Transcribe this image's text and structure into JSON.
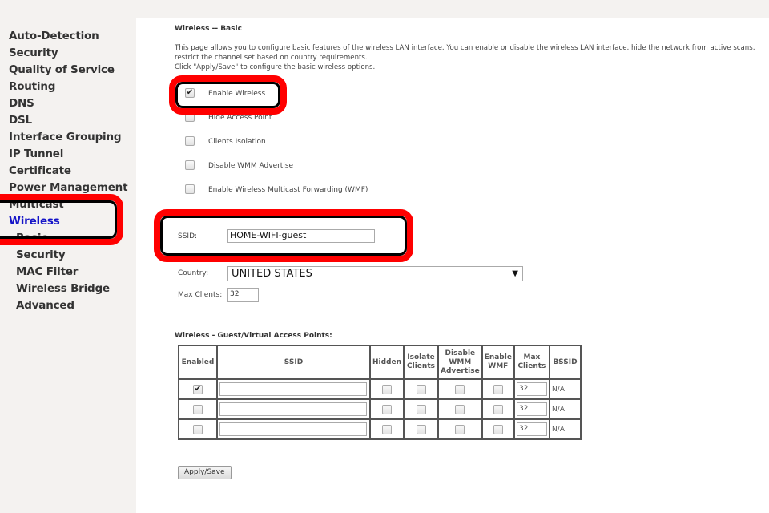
{
  "sidebar": {
    "items": [
      {
        "label": "Auto-Detection"
      },
      {
        "label": "Security"
      },
      {
        "label": "Quality of Service"
      },
      {
        "label": "Routing"
      },
      {
        "label": "DNS"
      },
      {
        "label": "DSL"
      },
      {
        "label": "Interface Grouping"
      },
      {
        "label": "IP Tunnel"
      },
      {
        "label": "Certificate"
      },
      {
        "label": "Power Management"
      },
      {
        "label": "Multicast"
      },
      {
        "label": "Wireless",
        "active": true
      },
      {
        "label": "Basic"
      },
      {
        "label": "Security"
      },
      {
        "label": "MAC Filter"
      },
      {
        "label": "Wireless Bridge"
      },
      {
        "label": "Advanced"
      }
    ],
    "active_color": "#1515c8"
  },
  "page": {
    "title": "Wireless -- Basic",
    "desc1": "This page allows you to configure basic features of the wireless LAN interface. You can enable or disable the wireless LAN interface, hide the network from active scans,",
    "desc2": "restrict the channel set based on country requirements.",
    "desc3": "Click \"Apply/Save\" to configure the basic wireless options."
  },
  "options": [
    {
      "label": "Enable Wireless",
      "checked": true
    },
    {
      "label": "Hide Access Point",
      "checked": false
    },
    {
      "label": "Clients Isolation",
      "checked": false
    },
    {
      "label": "Disable WMM Advertise",
      "checked": false
    },
    {
      "label": "Enable Wireless Multicast Forwarding (WMF)",
      "checked": false
    }
  ],
  "form": {
    "ssid_label": "SSID:",
    "ssid_value": "HOME-WIFI-guest",
    "country_label": "Country:",
    "country_value": "UNITED STATES",
    "max_label": "Max Clients:",
    "max_value": "32"
  },
  "guest": {
    "title": "Wireless - Guest/Virtual Access Points:",
    "headers": [
      "Enabled",
      "SSID",
      "Hidden",
      "Isolate Clients",
      "Disable WMM Advertise",
      "Enable WMF",
      "Max Clients",
      "BSSID"
    ],
    "rows": [
      {
        "enabled": true,
        "ssid": "",
        "max": "32",
        "bssid": "N/A"
      },
      {
        "enabled": false,
        "ssid": "",
        "max": "32",
        "bssid": "N/A"
      },
      {
        "enabled": false,
        "ssid": "",
        "max": "32",
        "bssid": "N/A"
      }
    ]
  },
  "apply_label": "Apply/Save",
  "annotation_color": "#ff0000"
}
